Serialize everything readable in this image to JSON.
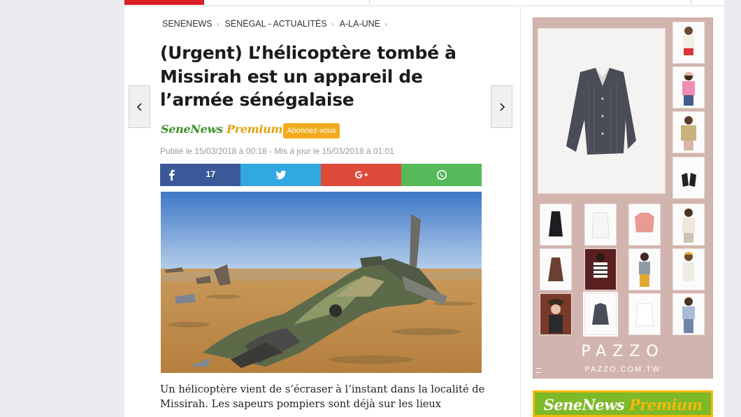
{
  "breadcrumb": {
    "items": [
      "SENENEWS",
      "SÉNÉGAL - ACTUALITÉS",
      "A-LA-UNE"
    ]
  },
  "article": {
    "title": "(Urgent) L’hélicoptère tombé à Missirah est un appareil de l’armée sénégalaise",
    "brand_logo_part1": "SeneNews",
    "brand_logo_part2": " Premium",
    "subscribe_label": "Abonnez-vous",
    "meta": "Publié le 15/03/2018 à 00:18 - Mis à jour le 15/03/2018 à 01:01",
    "body": "Un hélicoptère vient de s’écraser à l’instant  dans la localité de Missirah. Les sapeurs pompiers sont déjà sur les lieux"
  },
  "share": {
    "facebook_count": "17",
    "icons": [
      "facebook-icon",
      "twitter-icon",
      "google-plus-icon",
      "whatsapp-icon"
    ],
    "colors": {
      "facebook": "#3b5998",
      "twitter": "#32a8e0",
      "google_plus": "#df4b3a",
      "whatsapp": "#56b95a"
    }
  },
  "ad": {
    "brand": "PAZZO",
    "url": "PAZZO.COM.TW"
  },
  "premium_banner": {
    "part1": "SeneNews",
    "part2": " Premium"
  },
  "colors": {
    "accent": "#d81f26",
    "subscribe": "#f2ab1f"
  }
}
